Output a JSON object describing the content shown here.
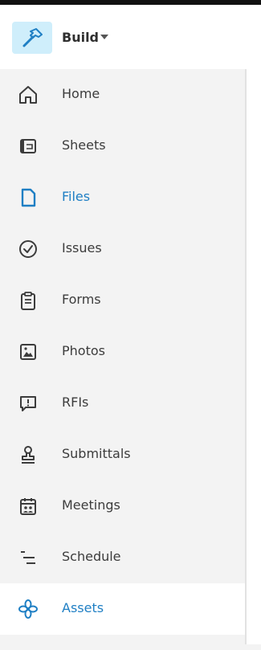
{
  "app": {
    "title": "Build"
  },
  "nav": {
    "items": [
      {
        "label": "Home",
        "icon": "home-icon"
      },
      {
        "label": "Sheets",
        "icon": "sheets-icon"
      },
      {
        "label": "Files",
        "icon": "file-icon"
      },
      {
        "label": "Issues",
        "icon": "check-circle-icon"
      },
      {
        "label": "Forms",
        "icon": "clipboard-icon"
      },
      {
        "label": "Photos",
        "icon": "photo-icon"
      },
      {
        "label": "RFIs",
        "icon": "speech-bubble-exclamation-icon"
      },
      {
        "label": "Submittals",
        "icon": "stamp-icon"
      },
      {
        "label": "Meetings",
        "icon": "calendar-people-icon"
      },
      {
        "label": "Schedule",
        "icon": "schedule-lines-icon"
      },
      {
        "label": "Assets",
        "icon": "asset-flower-icon"
      }
    ],
    "active": "Files",
    "selected": "Assets"
  },
  "colors": {
    "accent": "#1f7fc4",
    "sidebar_bg": "#f3f3f3",
    "badge_bg": "#cfeefb"
  }
}
